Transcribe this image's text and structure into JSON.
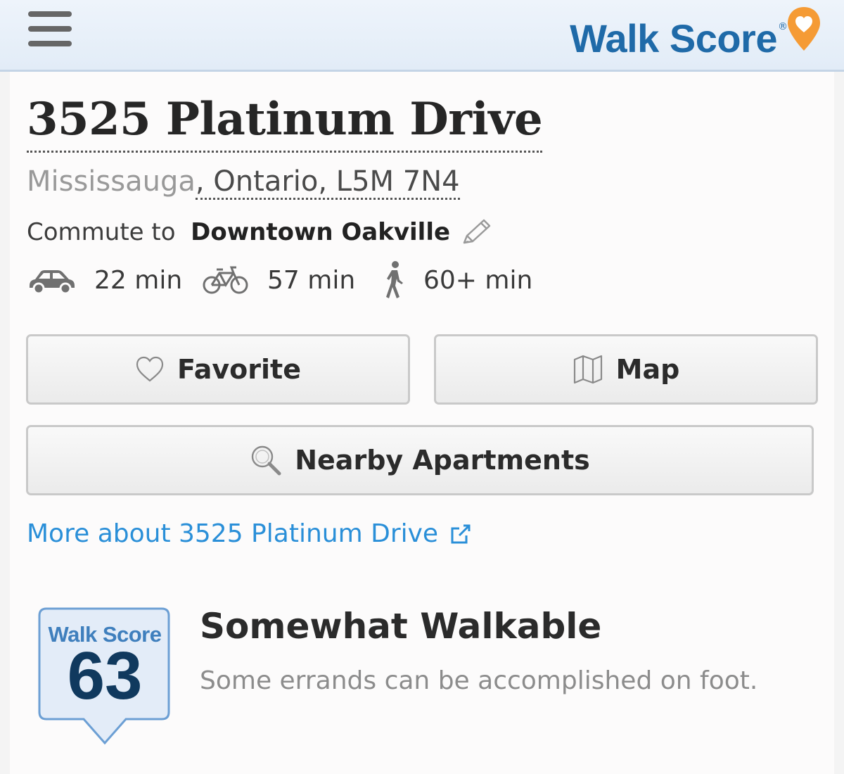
{
  "header": {
    "logo_text": "Walk Score",
    "logo_registered": "®",
    "menu_icon": "hamburger-menu-icon",
    "pin_icon": "location-pin-heart-icon",
    "colors": {
      "brand_blue": "#1f6aa8",
      "pin_orange": "#f59b35"
    }
  },
  "address": {
    "street": "3525 Platinum Drive",
    "city": "Mississauga",
    "region": ", Ontario, L5M 7N4"
  },
  "commute": {
    "prefix": "Commute to ",
    "destination": "Downtown Oakville",
    "edit_icon": "pencil-icon",
    "modes": [
      {
        "icon": "car-icon",
        "time": "22 min"
      },
      {
        "icon": "bicycle-icon",
        "time": "57 min"
      },
      {
        "icon": "walking-person-icon",
        "time": "60+ min"
      }
    ]
  },
  "buttons": {
    "favorite": "Favorite",
    "map": "Map",
    "nearby": "Nearby Apartments"
  },
  "more_link": "More about 3525 Platinum Drive",
  "score": {
    "badge_label": "Walk Score",
    "value": "63",
    "rating": "Somewhat Walkable",
    "description": "Some errands can be accomplished on foot."
  }
}
